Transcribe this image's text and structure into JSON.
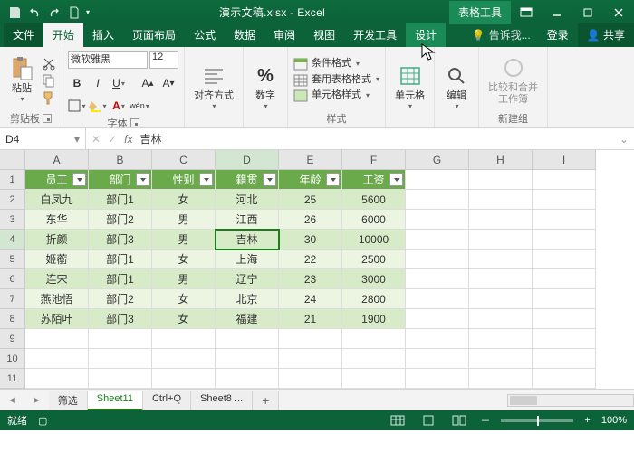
{
  "title": "演示文稿.xlsx - Excel",
  "tool_tab": "表格工具",
  "tabs": {
    "file": "文件",
    "home": "开始",
    "insert": "插入",
    "layout": "页面布局",
    "formula": "公式",
    "data": "数据",
    "review": "审阅",
    "view": "视图",
    "dev": "开发工具",
    "design": "设计"
  },
  "tell_me": "告诉我...",
  "signin": "登录",
  "share": "共享",
  "groups": {
    "clipboard": "剪贴板",
    "font": "字体",
    "align": "对齐方式",
    "number": "数字",
    "styles": "样式",
    "cells": "单元格",
    "editing": "编辑",
    "newgroup": "新建组",
    "compare": "比较和合并\n工作簿"
  },
  "font": {
    "name": "微软雅黑",
    "size": "12"
  },
  "paste": "粘贴",
  "style_items": {
    "cond": "条件格式",
    "table": "套用表格格式",
    "cell": "单元格样式"
  },
  "namebox": "D4",
  "formula_val": "吉林",
  "cols": [
    "A",
    "B",
    "C",
    "D",
    "E",
    "F",
    "G",
    "H",
    "I"
  ],
  "headers": [
    "员工",
    "部门",
    "性别",
    "籍贯",
    "年龄",
    "工资"
  ],
  "rows": [
    [
      "白凤九",
      "部门1",
      "女",
      "河北",
      "25",
      "5600"
    ],
    [
      "东华",
      "部门2",
      "男",
      "江西",
      "26",
      "6000"
    ],
    [
      "折颜",
      "部门3",
      "男",
      "吉林",
      "30",
      "10000"
    ],
    [
      "姬蘅",
      "部门1",
      "女",
      "上海",
      "22",
      "2500"
    ],
    [
      "连宋",
      "部门1",
      "男",
      "辽宁",
      "23",
      "3000"
    ],
    [
      "燕池悟",
      "部门2",
      "女",
      "北京",
      "24",
      "2800"
    ],
    [
      "苏陌叶",
      "部门3",
      "女",
      "福建",
      "21",
      "1900"
    ]
  ],
  "sheet_tabs": [
    "筛选",
    "Sheet11",
    "Ctrl+Q",
    "Sheet8 ..."
  ],
  "active_sheet": 1,
  "status": "就绪",
  "zoom": "100%",
  "zoom_plus": "+",
  "zoom_minus": "－",
  "new_sheet": "+"
}
